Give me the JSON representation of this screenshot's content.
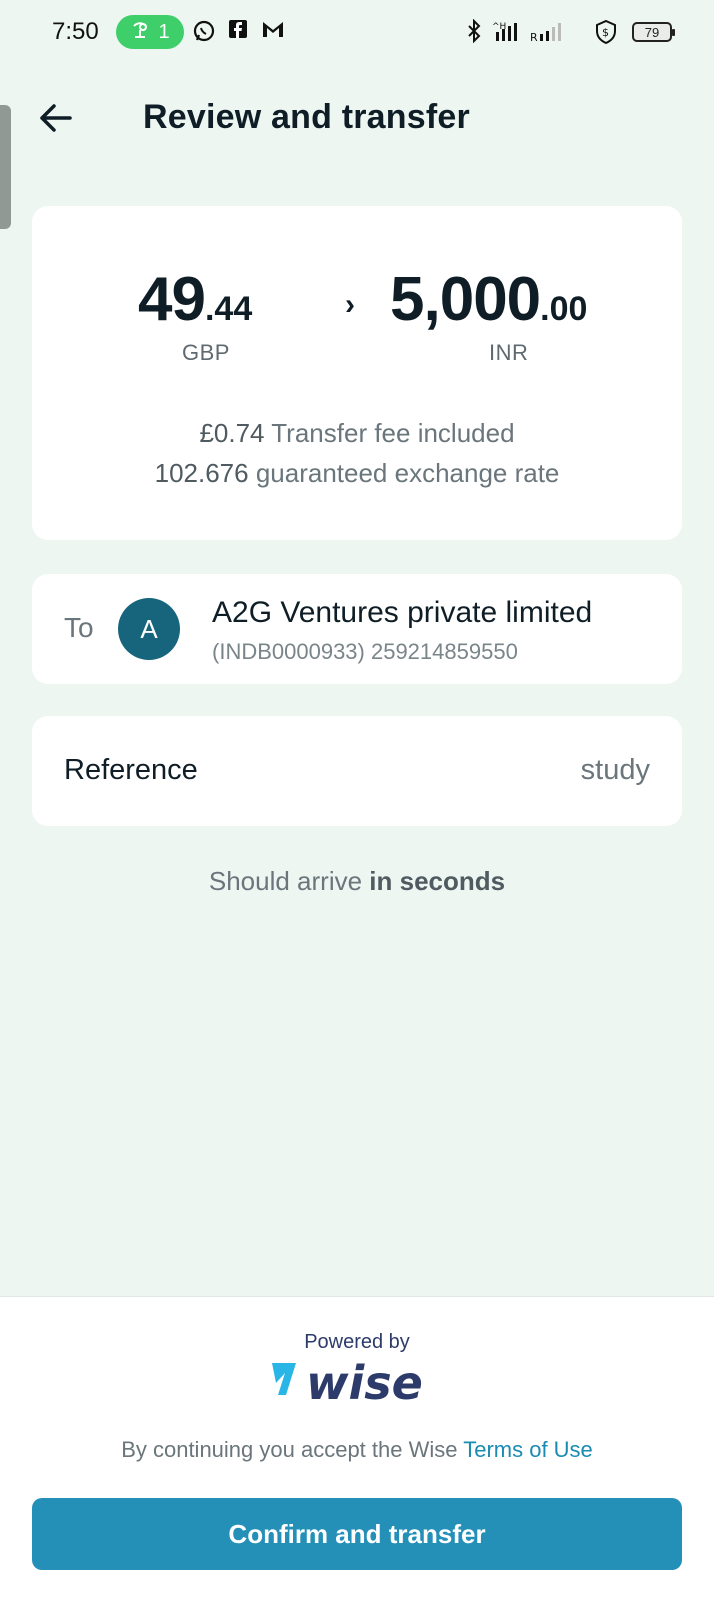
{
  "status_bar": {
    "time": "7:50",
    "hotspot_count": "1",
    "network_label": "R",
    "battery": "79",
    "icons": [
      "hotspot-icon",
      "whatsapp-icon",
      "facebook-icon",
      "gmail-icon",
      "bluetooth-icon",
      "signal-icon",
      "shield-icon",
      "battery-icon"
    ]
  },
  "header": {
    "title": "Review and transfer",
    "back_icon": "back-arrow-icon"
  },
  "transfer": {
    "from_amount_int": "49",
    "from_amount_dec": ".44",
    "from_currency": "GBP",
    "to_amount_int": "5,000",
    "to_amount_dec": ".00",
    "to_currency": "INR",
    "fee_amount": "£0.74",
    "fee_text": " Transfer fee included",
    "rate_value": "102.676",
    "rate_text": " guaranteed exchange rate"
  },
  "recipient": {
    "to_label": "To",
    "avatar_letter": "A",
    "name": "A2G Ventures private limited",
    "account": "(INDB0000933) 259214859550"
  },
  "reference": {
    "label": "Reference",
    "value": "study"
  },
  "arrival": {
    "prefix": "Should arrive ",
    "bold": "in seconds"
  },
  "footer": {
    "powered_by": "Powered by",
    "brand": "wise",
    "terms_prefix": "By continuing you accept the Wise ",
    "terms_link": "Terms of Use",
    "confirm_label": "Confirm and transfer"
  },
  "colors": {
    "background": "#eef6f2",
    "primary_button": "#2490b8",
    "avatar": "#17657c",
    "brand_blue": "#2d3b6a",
    "link": "#1b8bb2"
  }
}
